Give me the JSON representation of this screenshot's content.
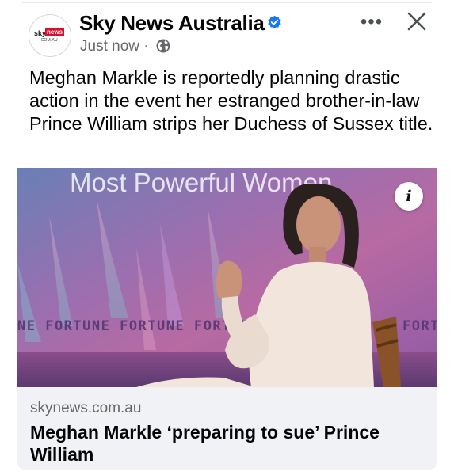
{
  "post": {
    "page_name": "Sky News Australia",
    "timestamp": "Just now",
    "separator": "·",
    "audience_icon": "globe-icon",
    "verified_icon": "verified-badge-icon",
    "text": "Meghan Markle is reportedly planning drastic action in the event her estranged brother-in-law Prince William strips her Duchess of Sussex title.",
    "avatar": {
      "logo_sky": "sky",
      "logo_news": "news",
      "logo_sub": ".COM.AU"
    }
  },
  "actions": {
    "more": "•••",
    "close_icon": "close-icon"
  },
  "photo": {
    "backdrop_title": "Most Powerful Women",
    "backdrop_banner": "NE FORTUNE FORTUNE FORTUNE",
    "backdrop_banner_right": "FORTU",
    "info_label": "i"
  },
  "link": {
    "domain": "skynews.com.au",
    "headline": "Meghan Markle ‘preparing to sue’ Prince William"
  },
  "colors": {
    "verified": "#1877f2",
    "brand_red": "#d8102f",
    "secondary_text": "#65676b",
    "card_bg": "#f0f2f5"
  }
}
